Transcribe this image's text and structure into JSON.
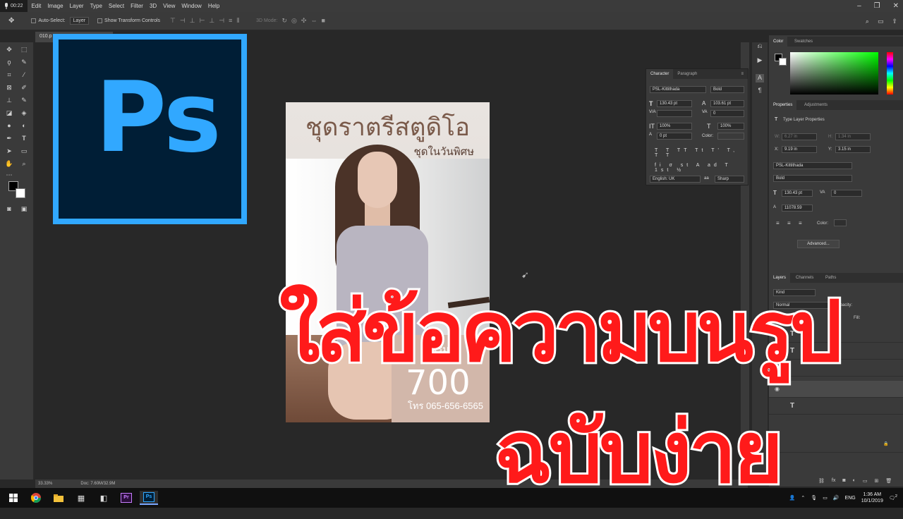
{
  "menubar": {
    "record_time": "00:22",
    "items": [
      "Edit",
      "Image",
      "Layer",
      "Type",
      "Select",
      "Filter",
      "3D",
      "View",
      "Window",
      "Help"
    ]
  },
  "options": {
    "auto_select_label": "Auto-Select:",
    "auto_select_value": "Layer",
    "transform_label": "Show Transform Controls",
    "mode_3d": "3D Mode:"
  },
  "document": {
    "tab_name": "010.p",
    "zoom": "33.33%",
    "doc_size": "Doc: 7.60M/32.9M"
  },
  "poster": {
    "title": "ชุดราตรีสตูดิโอ",
    "subtitle": "ชุดในวันพิศษ",
    "start": "เริ่ม",
    "price": "700",
    "phone": "โทร 065-656-6565"
  },
  "overlay": {
    "line1": "ใส่ข้อความบนรูป",
    "line2": "ฉบับง่าย"
  },
  "character_panel": {
    "tabs": [
      "Character",
      "Paragraph"
    ],
    "font": "PSL-Kittithada",
    "style": "Bold",
    "size": "130.43 pt",
    "leading": "103.61 pt",
    "tracking": "0",
    "vscale": "100%",
    "hscale": "100%",
    "baseline": "0 pt",
    "color_label": "Color:",
    "language": "English: UK",
    "antialias": "Sharp",
    "type_buttons": "T T TT Tt T' T, T T",
    "opentype_buttons": "fi σ st A ad T 1st ½"
  },
  "color_panel": {
    "tabs": [
      "Color",
      "Swatches"
    ]
  },
  "properties_panel": {
    "tabs": [
      "Properties",
      "Adjustments"
    ],
    "header": "Type Layer Properties",
    "w_label": "W:",
    "w_value": "6.27 in",
    "h_label": "H:",
    "h_value": "1.34 in",
    "x_label": "X:",
    "x_value": "9.19 in",
    "y_label": "Y:",
    "y_value": "3.15 in",
    "font": "PSL-Kittithada",
    "style": "Bold",
    "size": "130.43 pt",
    "tracking": "0",
    "leading": "11078.59",
    "color_label": "Color:",
    "advanced": "Advanced..."
  },
  "layers_panel": {
    "tabs": [
      "Layers",
      "Channels",
      "Paths"
    ],
    "kind": "Kind",
    "blend": "Normal",
    "opacity_label": "Opacity:",
    "fill_label": "Fill:"
  },
  "taskbar": {
    "lang": "ENG",
    "time": "1:36 AM",
    "date": "10/1/2019",
    "notif": "2"
  },
  "colors": {
    "ps_blue": "#31a8ff",
    "ps_dark": "#001e36",
    "overlay_red": "#ff1a1a"
  }
}
